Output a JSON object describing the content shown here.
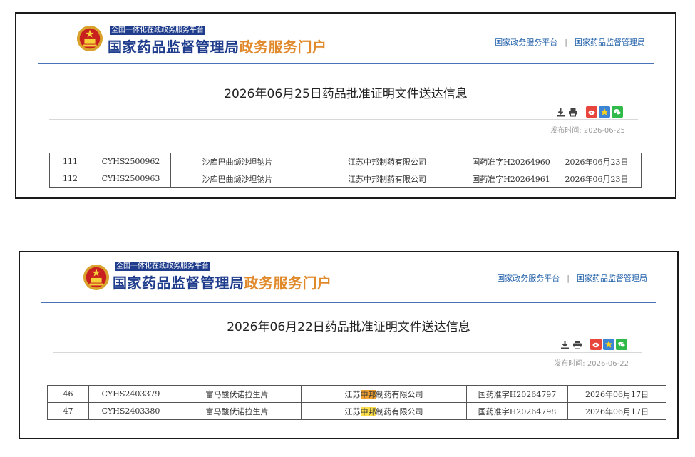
{
  "portal": {
    "slogan": "全国一体化在线政务服务平台",
    "name_main": "国家药品监督管理局",
    "name_accent": "政务服务门户",
    "links": [
      "国家政务服务平台",
      "国家药品监督管理局"
    ],
    "link_separator": "|"
  },
  "colors": {
    "brand_blue": "#1f3d8c",
    "accent_orange": "#e08a2c",
    "link_blue": "#1f5fa8",
    "header_rule": "#4a72b8"
  },
  "icons": [
    "download-icon",
    "print-icon",
    "weibo-share-icon",
    "favorite-star-icon",
    "wechat-share-icon"
  ],
  "notices": [
    {
      "title": "2026年06月25日药品批准证明文件送达信息",
      "publish_label": "发布时间:",
      "publish_date": "2026-06-25",
      "rows": [
        {
          "no": "111",
          "code": "CYHS2500962",
          "drug": "沙库巴曲缬沙坦钠片",
          "company": "江苏中邦制药有限公司",
          "approval": "国药准字H20264960",
          "date": "2026年06月23日"
        },
        {
          "no": "112",
          "code": "CYHS2500963",
          "drug": "沙库巴曲缬沙坦钠片",
          "company": "江苏中邦制药有限公司",
          "approval": "国药准字H20264961",
          "date": "2026年06月23日"
        }
      ]
    },
    {
      "title": "2026年06月22日药品批准证明文件送达信息",
      "publish_label": "发布时间:",
      "publish_date": "2026-06-22",
      "rows": [
        {
          "no": "46",
          "code": "CYHS2403379",
          "drug": "富马酸伏诺拉生片",
          "company_pre": "江苏",
          "company_hl": "中邦",
          "company_post": "制药有限公司",
          "approval": "国药准字H20264797",
          "date": "2026年06月17日"
        },
        {
          "no": "47",
          "code": "CYHS2403380",
          "drug": "富马酸伏诺拉生片",
          "company_pre": "江苏",
          "company_hl": "中邦",
          "company_post": "制药有限公司",
          "approval": "国药准字H20264798",
          "date": "2026年06月17日"
        }
      ]
    }
  ]
}
